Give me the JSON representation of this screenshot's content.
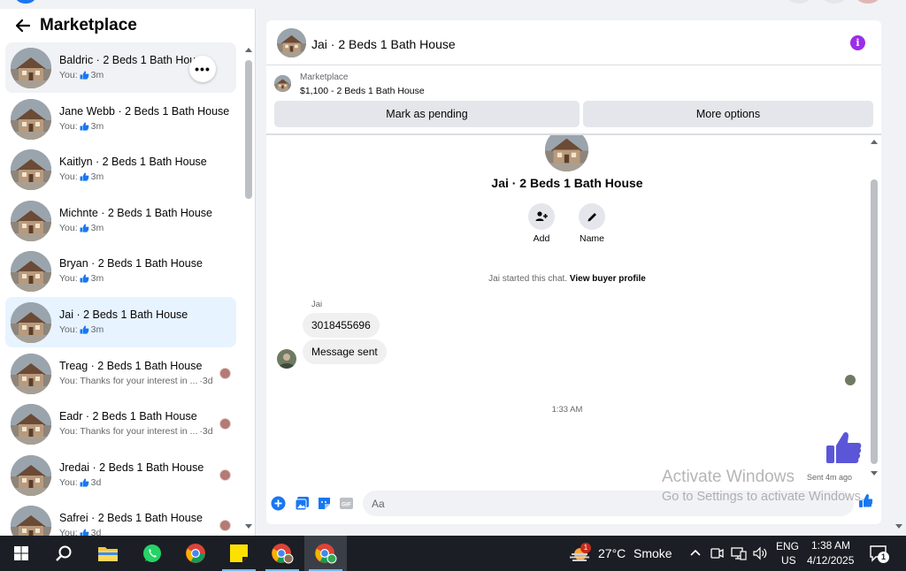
{
  "colors": {
    "accent": "#1877f2",
    "info": "#9b2ee8",
    "active_conversation_bg": "#e7f3ff",
    "taskbar_bg": "#1b1e24"
  },
  "left": {
    "title": "Marketplace",
    "conversations": [
      {
        "name": "Baldric · 2 Beds 1 Bath House",
        "preview": "You:",
        "time": "3m",
        "liked": true,
        "state": "hover"
      },
      {
        "name": "Jane Webb · 2 Beds 1 Bath House",
        "preview": "You:",
        "time": "3m",
        "liked": true
      },
      {
        "name": "Kaitlyn · 2 Beds 1 Bath House",
        "preview": "You:",
        "time": "3m",
        "liked": true
      },
      {
        "name": "Michnte · 2 Beds 1 Bath House",
        "preview": "You:",
        "time": "3m",
        "liked": true
      },
      {
        "name": "Bryan · 2 Beds 1 Bath House",
        "preview": "You:",
        "time": "3m",
        "liked": true
      },
      {
        "name": "Jai · 2 Beds 1 Bath House",
        "preview": "You:",
        "time": "3m",
        "liked": true,
        "state": "active"
      },
      {
        "name": "Treag · 2 Beds 1 Bath House",
        "preview": "You: Thanks for your interest in ...",
        "time": "·3d",
        "liked": false,
        "seen_avatar": true
      },
      {
        "name": "Eadr · 2 Beds 1 Bath House",
        "preview": "You: Thanks for your interest in ...",
        "time": "·3d",
        "liked": false,
        "seen_avatar": true
      },
      {
        "name": "Jredai · 2 Beds 1 Bath House",
        "preview": "You:",
        "time": "3d",
        "liked": true,
        "seen_avatar": true
      },
      {
        "name": "Safrei · 2 Beds 1 Bath House",
        "preview": "You:",
        "time": "3d",
        "liked": true,
        "seen_avatar": true
      }
    ],
    "more_label": "•••"
  },
  "chat": {
    "title": "Jai · 2 Beds 1 Bath House",
    "info_label": "i",
    "listing_source": "Marketplace",
    "listing_summary": "$1,100 - 2 Beds 1 Bath House",
    "mark_pending": "Mark as pending",
    "more_options": "More options",
    "profile_title": "Jai · 2 Beds 1 Bath House",
    "add_label": "Add",
    "name_label": "Name",
    "started_text": "Jai started this chat.",
    "view_buyer_profile": "View buyer profile",
    "sender": "Jai",
    "messages": [
      "3018455696",
      "Message sent"
    ],
    "timestamp": "1:33 AM",
    "sent_ago": "Sent 4m ago",
    "input_placeholder": "Aa"
  },
  "watermark": {
    "line1": "Activate Windows",
    "line2": "Go to Settings to activate Windows."
  },
  "taskbar": {
    "weather_temp": "27°C",
    "weather_desc": "Smoke",
    "weather_badge": "1",
    "lang": "ENG",
    "region": "US",
    "time": "1:38 AM",
    "date": "4/12/2025",
    "notif_count": "1",
    "icons": [
      "windows-start-icon",
      "search-icon",
      "file-explorer-icon",
      "whatsapp-icon",
      "chrome-icon",
      "sticky-notes-icon",
      "chrome-profile-icon",
      "chrome-profile-icon"
    ]
  }
}
